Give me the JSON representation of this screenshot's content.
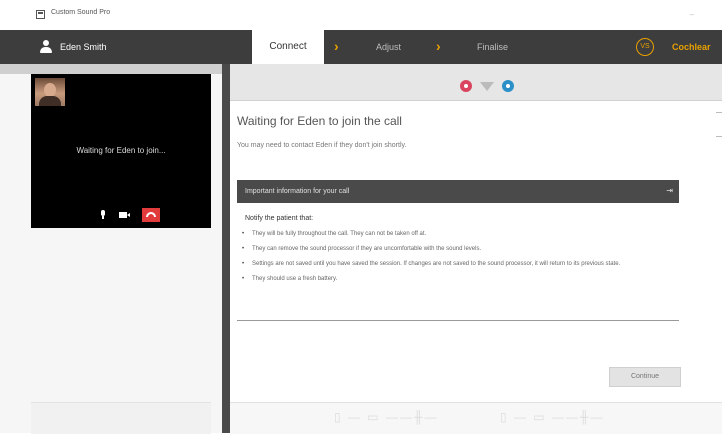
{
  "window": {
    "title": "Custom Sound Pro",
    "minimize": "–"
  },
  "topbar": {
    "user_name": "Eden Smith",
    "steps": [
      {
        "label": "Connect"
      },
      {
        "label": "Adjust"
      },
      {
        "label": "Finalise"
      }
    ],
    "chevron": "›",
    "audiologist_initials": "VS",
    "brand": "Cochlear"
  },
  "video_panel": {
    "status": "Waiting for Eden to join..."
  },
  "main": {
    "heading": "Waiting for Eden to join the call",
    "subtext": "You may need to contact Eden if they don't join shortly.",
    "info": {
      "title": "Important information for your call",
      "toggle": "⇥",
      "notify_heading": "Notify the patient that:",
      "bullets": [
        "They will be fully throughout the call. They can not be taken off at.",
        "They can remove the sound processor if they are uncomfortable with the sound levels.",
        "Settings are not saved until you have saved the session. If changes are not saved to the sound processor, it will return to its previous state.",
        "They should use a fresh battery."
      ]
    },
    "continue_label": "Continue"
  },
  "bottom_strip": {
    "glyphs_a": "▯ — ▭ ——╫—",
    "glyphs_b": "▯ — ▭ ——╫—"
  },
  "colors": {
    "accent": "#e8a000",
    "topbar": "#3d3d3d",
    "end_call": "#e23b3b",
    "dot_red": "#d9455f",
    "dot_blue": "#2b90c7"
  }
}
